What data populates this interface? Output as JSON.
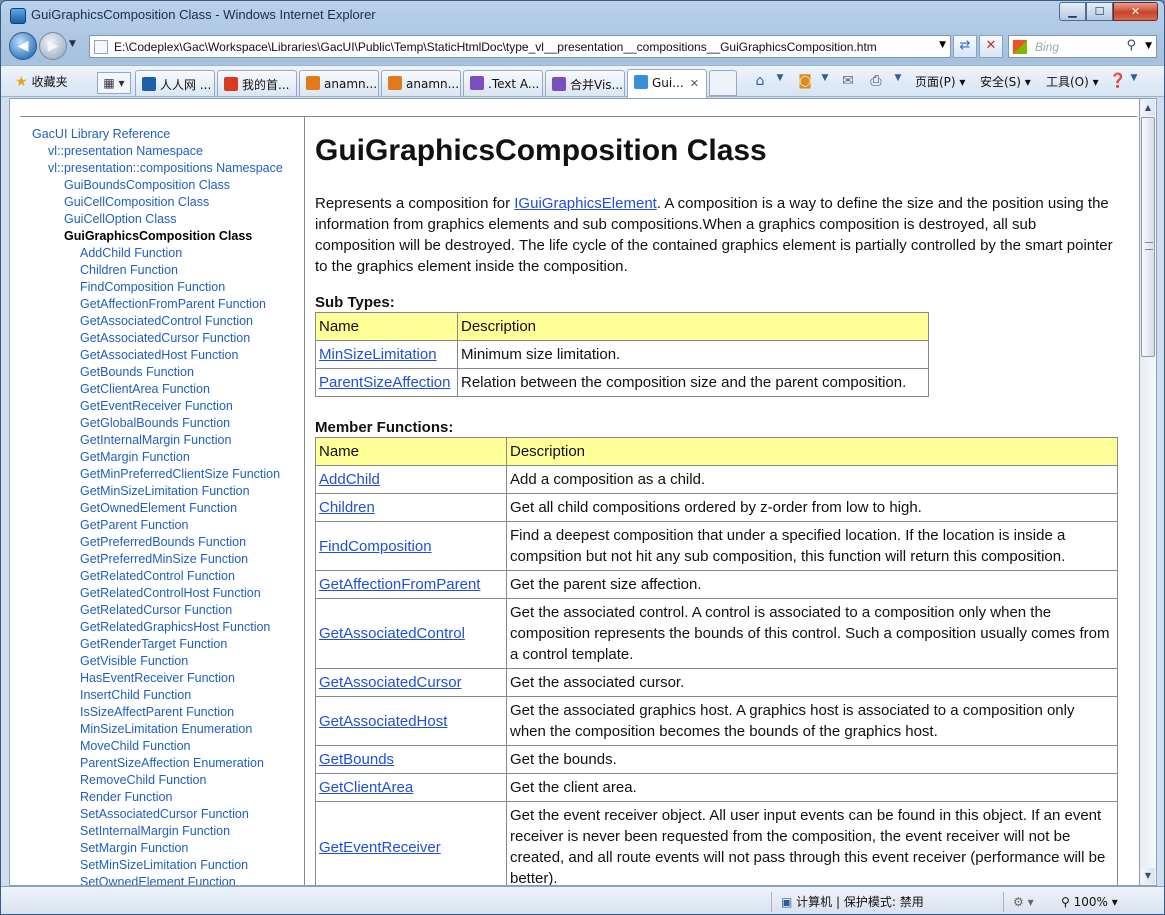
{
  "window": {
    "title": "GuiGraphicsComposition Class - Windows Internet Explorer",
    "min": "▁",
    "max": "☐",
    "close": "✕"
  },
  "nav": {
    "back_icon": "arrow-left-icon",
    "forward_icon": "arrow-right-icon",
    "url": "E:\\Codeplex\\Gac\\Workspace\\Libraries\\GacUI\\Public\\Temp\\StaticHtmlDoc\\type_vl__presentation__compositions__GuiGraphicsComposition.htm",
    "search_placeholder": "Bing"
  },
  "favorites": {
    "label": "收藏夹",
    "tabs": [
      {
        "label": "人人网 ...",
        "color": "#1d5fa8"
      },
      {
        "label": "我的首...",
        "color": "#d93b22"
      },
      {
        "label": "anamn...",
        "color": "#e07a1a"
      },
      {
        "label": "anamn...",
        "color": "#e07a1a"
      },
      {
        "label": ".Text A...",
        "color": "#7a4fbf"
      },
      {
        "label": "合并Vis...",
        "color": "#7a4fbf"
      },
      {
        "label": "Gui...",
        "color": "#3a8fd9"
      }
    ],
    "commands": {
      "page": "页面(P)",
      "safety": "安全(S)",
      "tools": "工具(O)"
    }
  },
  "sidebar": {
    "root": "GacUI Library Reference",
    "ns1": "vl::presentation Namespace",
    "ns2": "vl::presentation::compositions Namespace",
    "classes": [
      "GuiBoundsComposition Class",
      "GuiCellComposition Class",
      "GuiCellOption Class"
    ],
    "current": "GuiGraphicsComposition Class",
    "members": [
      "AddChild Function",
      "Children Function",
      "FindComposition Function",
      "GetAffectionFromParent Function",
      "GetAssociatedControl Function",
      "GetAssociatedCursor Function",
      "GetAssociatedHost Function",
      "GetBounds Function",
      "GetClientArea Function",
      "GetEventReceiver Function",
      "GetGlobalBounds Function",
      "GetInternalMargin Function",
      "GetMargin Function",
      "GetMinPreferredClientSize Function",
      "GetMinSizeLimitation Function",
      "GetOwnedElement Function",
      "GetParent Function",
      "GetPreferredBounds Function",
      "GetPreferredMinSize Function",
      "GetRelatedControl Function",
      "GetRelatedControlHost Function",
      "GetRelatedCursor Function",
      "GetRelatedGraphicsHost Function",
      "GetRenderTarget Function",
      "GetVisible Function",
      "HasEventReceiver Function",
      "InsertChild Function",
      "IsSizeAffectParent Function",
      "MinSizeLimitation Enumeration",
      "MoveChild Function",
      "ParentSizeAffection Enumeration",
      "RemoveChild Function",
      "Render Function",
      "SetAssociatedCursor Function",
      "SetInternalMargin Function",
      "SetMargin Function",
      "SetMinSizeLimitation Function",
      "SetOwnedElement Function"
    ]
  },
  "main": {
    "title": "GuiGraphicsComposition Class",
    "desc_prefix": "Represents a composition for ",
    "desc_link": "IGuiGraphicsElement",
    "desc_suffix": ". A composition is a way to define the size and the position using the information from graphics elements and sub compositions.When a graphics composition is destroyed, all sub composition will be destroyed. The life cycle of the contained graphics element is partially controlled by the smart pointer to the graphics element inside the composition.",
    "subtypes_heading": "Sub Types:",
    "col_name": "Name",
    "col_desc": "Description",
    "subtypes": [
      {
        "name": "MinSizeLimitation",
        "desc": "Minimum size limitation."
      },
      {
        "name": "ParentSizeAffection",
        "desc": "Relation between the composition size and the parent composition."
      }
    ],
    "members_heading": "Member Functions:",
    "members": [
      {
        "name": "AddChild",
        "desc": "Add a composition as a child."
      },
      {
        "name": "Children",
        "desc": "Get all child compositions ordered by z-order from low to high."
      },
      {
        "name": "FindComposition",
        "desc": "Find a deepest composition that under a specified location. If the location is inside a compsition but not hit any sub composition, this function will return this composition."
      },
      {
        "name": "GetAffectionFromParent",
        "desc": "Get the parent size affection."
      },
      {
        "name": "GetAssociatedControl",
        "desc": "Get the associated control. A control is associated to a composition only when the composition represents the bounds of this control. Such a composition usually comes from a control template."
      },
      {
        "name": "GetAssociatedCursor",
        "desc": "Get the associated cursor."
      },
      {
        "name": "GetAssociatedHost",
        "desc": "Get the associated graphics host. A graphics host is associated to a composition only when the composition becomes the bounds of the graphics host."
      },
      {
        "name": "GetBounds",
        "desc": "Get the bounds."
      },
      {
        "name": "GetClientArea",
        "desc": "Get the client area."
      },
      {
        "name": "GetEventReceiver",
        "desc": "Get the event receiver object. All user input events can be found in this object. If an event receiver is never been requested from the composition, the event receiver will not be created, and all route events will not pass through this event receiver (performance will be better)."
      }
    ]
  },
  "status": {
    "zone": "计算机 | 保护模式: 禁用",
    "zoom": "100%"
  }
}
